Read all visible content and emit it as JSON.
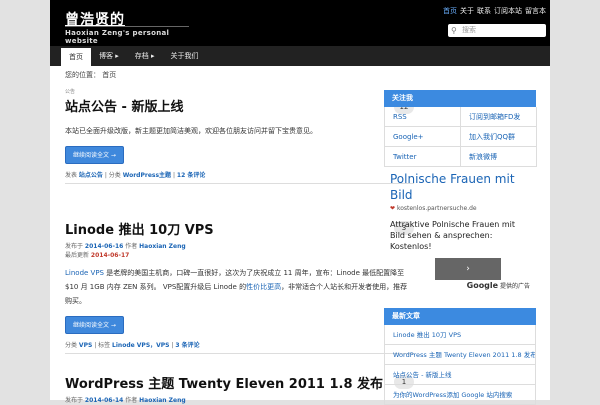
{
  "header": {
    "site_title": "曾浩贤的",
    "site_description": "Haoxian Zeng's personal website",
    "top_links": [
      "首页",
      "关于",
      "联系",
      "订阅本站",
      "留言本"
    ],
    "search_placeholder": "搜索"
  },
  "nav": {
    "items": [
      "首页",
      "博客 ▸",
      "存档 ▸",
      "关于我们"
    ]
  },
  "breadcrumb": "您的位置： 首页",
  "posts": [
    {
      "tag": "公告",
      "title": "站点公告 - 新版上线",
      "comments": "12",
      "body": "本站已全面升级改版，新主题更加简洁美观，欢迎各位朋友访问并留下宝贵意见。",
      "read_more": "继续阅读全文 →",
      "footer_prefix": "发表 ",
      "footer_link1": "站点公告",
      "footer_mid": " | 分类 ",
      "footer_link2": "WordPress主题",
      "footer_sep": " | ",
      "footer_link3": "12 条评论"
    },
    {
      "tag": "",
      "title": "Linode 推出 10刀 VPS",
      "comments": "3",
      "meta_label1": "发布于 ",
      "meta_date": "2014-06-16",
      "meta_by": " 作者 ",
      "meta_author": "Haoxian Zeng",
      "meta_label2": "最后更新 ",
      "meta_updated": "2014-06-17",
      "body_link": "Linode VPS",
      "body_text": " 是老牌的美国主机商，口碑一直很好，这次为了庆祝成立 11 周年，宣布：Linode 最低配置降至 $10 月 1GB 内存 ZEN 系列。 VPS配置升级后 Linode 的",
      "body_link2": "性价比更高",
      "body_text2": "，非常适合个人站长和开发者使用，推荐购买。",
      "read_more": "继续阅读全文 →",
      "footer_prefix": "分类 ",
      "footer_link1": "VPS",
      "footer_mid": " | 标签 ",
      "footer_link2": "Linode VPS，VPS",
      "footer_sep": " | ",
      "footer_link3": "3 条评论"
    },
    {
      "tag": "",
      "title": "WordPress 主题 Twenty Eleven 2011 1.8 发布",
      "comments": "1",
      "meta_label1": "发布于 ",
      "meta_date": "2014-06-14",
      "meta_by": " 作者 ",
      "meta_author": "Haoxian Zeng"
    }
  ],
  "sidebar": {
    "follow_title": "关注我",
    "follow_links": [
      "RSS",
      "订阅到邮箱FD发",
      "Google+",
      "加入我们QQ群",
      "Twitter",
      "新浪微博"
    ],
    "ad": {
      "headline": "Polnische Frauen mit Bild",
      "url": "kostenlos.partnersuche.de",
      "text": "Attraktive Polnische Frauen mit Bild sehen & ansprechen: Kostenlos!",
      "button": "›",
      "badge_brand": "Google",
      "badge_text": " 提供的广告"
    },
    "recent_title": "最新文章",
    "recent_items": [
      "Linode 推出 10刀 VPS",
      "WordPress 主题 Twenty Eleven 2011 1.8 发布",
      "站点公告 - 新版上线",
      "为你的WordPress添加 Google 站内搜索"
    ]
  },
  "colors": {
    "header_bg": "#000000",
    "nav_bg": "#222222",
    "accent": "#3c8ae0",
    "link": "#1a64b5"
  }
}
